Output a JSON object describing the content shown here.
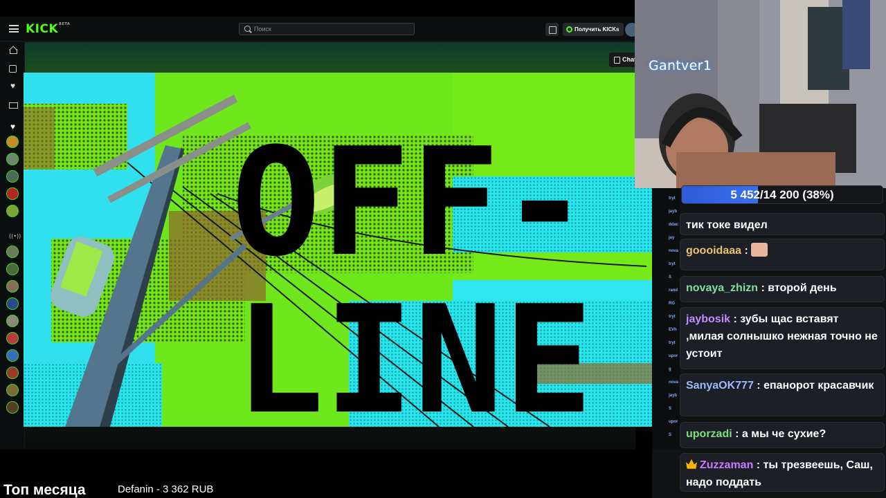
{
  "kick": {
    "logo": "KICK",
    "logo_badge": "BETA",
    "search_placeholder": "Поиск",
    "get_kicks_label": "Получить KICKs",
    "chat_button_label": "Chat"
  },
  "offline_banner": {
    "line1": "OFF-",
    "line2": "LINE"
  },
  "webcam": {
    "streamer_name": "Gantver1"
  },
  "goal": {
    "text": "5 452/14 200 (38%)",
    "progress": 0.38
  },
  "chat_messages": [
    {
      "user": "",
      "text": "тик токе видел",
      "user_color": "#ffffff"
    },
    {
      "user": "goooidaaa",
      "text": "",
      "user_color": "#e9c46a",
      "emote": true
    },
    {
      "user": "novaya_zhizn",
      "text": "второй день",
      "user_color": "#7ee0a0"
    },
    {
      "user": "jaybosik",
      "text": "зубы щас вставят ,милая солнышко нежная точно не устоит",
      "user_color": "#c48cff"
    },
    {
      "user": "SanyaOK777",
      "text": "епанорот красавчик",
      "user_color": "#9fb8ff"
    },
    {
      "user": "uporzadi",
      "text": "а мы че сухие?",
      "user_color": "#7ee07e"
    },
    {
      "user": "Zuzzaman",
      "text": "ты трезвеешь, Саш, надо поддать",
      "user_color": "#c77dff",
      "crown": true
    }
  ],
  "chat_under_names": [
    "tryt",
    "jayb",
    "ddac",
    "jay",
    "nova",
    "tryt",
    "S",
    "rand",
    "RG",
    "tryt",
    "EVh",
    "tryt",
    "upor",
    "g",
    "nova",
    "jayb",
    "S",
    "upor",
    "S"
  ],
  "bottom_bar": {
    "title": "Топ месяца",
    "top_donor": "Defanin - 3 362 RUB"
  },
  "colors": {
    "kick_green": "#53fc18",
    "banner_cyan": "#27e8f0",
    "goal_blue": "#3a6ff0"
  }
}
